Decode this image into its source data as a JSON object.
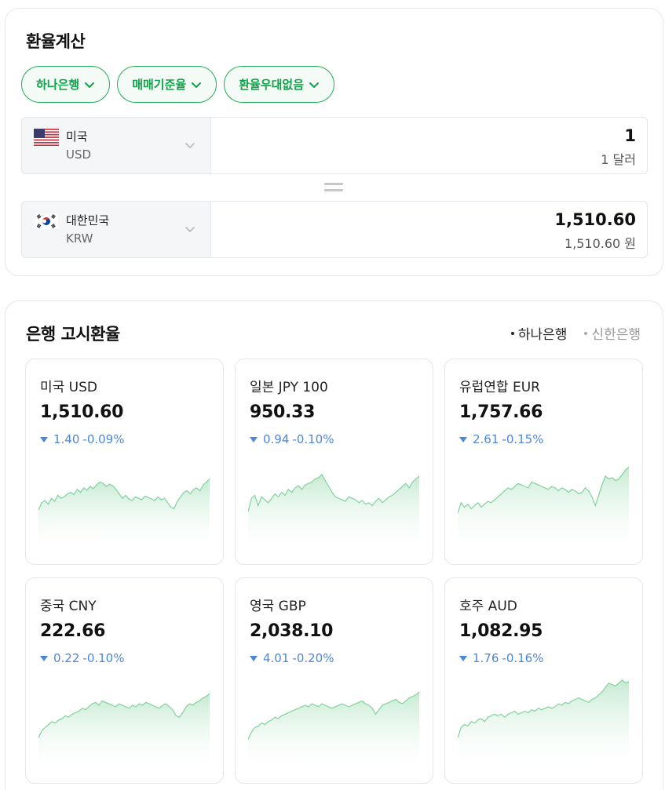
{
  "calculator": {
    "title": "환율계산",
    "chips": [
      {
        "label": "하나은행"
      },
      {
        "label": "매매기준율"
      },
      {
        "label": "환율우대없음"
      }
    ],
    "from": {
      "country": "미국",
      "code": "USD",
      "amount": "1",
      "amount_text": "1 달러"
    },
    "to": {
      "country": "대한민국",
      "code": "KRW",
      "amount": "1,510.60",
      "amount_text": "1,510.60 원"
    }
  },
  "rates": {
    "title": "은행 고시환율",
    "bank_tabs": [
      {
        "label": "하나은행",
        "active": true
      },
      {
        "label": "신한은행",
        "active": false
      }
    ],
    "cards": [
      {
        "name": "미국 USD",
        "value": "1,510.60",
        "change": "1.40",
        "change_pct": "-0.09%",
        "direction": "down",
        "trend": [
          42,
          52,
          55,
          50,
          58,
          54,
          62,
          58,
          60,
          64,
          66,
          63,
          70,
          66,
          72,
          69,
          74,
          71,
          76,
          80,
          78,
          74,
          77,
          75,
          70,
          64,
          58,
          62,
          57,
          55,
          60,
          58,
          56,
          61,
          59,
          57,
          55,
          60,
          56,
          58,
          52,
          46,
          44,
          54,
          60,
          66,
          68,
          64,
          70,
          72,
          68,
          76,
          80,
          84
        ]
      },
      {
        "name": "일본 JPY 100",
        "value": "950.33",
        "change": "0.94",
        "change_pct": "-0.10%",
        "direction": "down",
        "trend": [
          40,
          58,
          62,
          48,
          60,
          56,
          52,
          58,
          64,
          60,
          66,
          62,
          70,
          66,
          72,
          75,
          70,
          76,
          78,
          80,
          84,
          86,
          90,
          82,
          74,
          66,
          60,
          58,
          56,
          54,
          60,
          58,
          56,
          52,
          55,
          50,
          52,
          48,
          54,
          58,
          52,
          56,
          60,
          62,
          66,
          70,
          74,
          78,
          72,
          80,
          84,
          88
        ]
      },
      {
        "name": "유럽연합 EUR",
        "value": "1,757.66",
        "change": "2.61",
        "change_pct": "-0.15%",
        "direction": "down",
        "trend": [
          38,
          52,
          46,
          50,
          44,
          48,
          52,
          46,
          50,
          54,
          52,
          56,
          60,
          64,
          68,
          72,
          70,
          74,
          78,
          76,
          74,
          72,
          80,
          78,
          76,
          74,
          72,
          70,
          74,
          72,
          68,
          72,
          70,
          66,
          70,
          68,
          64,
          66,
          72,
          68,
          60,
          48,
          62,
          76,
          88,
          84,
          86,
          82,
          84,
          90,
          96,
          100
        ]
      },
      {
        "name": "중국 CNY",
        "value": "222.66",
        "change": "0.22",
        "change_pct": "-0.10%",
        "direction": "down",
        "trend": [
          30,
          40,
          44,
          48,
          52,
          50,
          54,
          56,
          60,
          58,
          62,
          64,
          66,
          70,
          68,
          72,
          76,
          78,
          74,
          80,
          78,
          76,
          74,
          72,
          76,
          74,
          72,
          70,
          74,
          72,
          76,
          74,
          78,
          76,
          74,
          72,
          70,
          74,
          76,
          72,
          68,
          60,
          58,
          64,
          72,
          76,
          74,
          78,
          80,
          84,
          86,
          90
        ]
      },
      {
        "name": "영국 GBP",
        "value": "2,038.10",
        "change": "4.01",
        "change_pct": "-0.20%",
        "direction": "down",
        "trend": [
          28,
          38,
          44,
          46,
          50,
          48,
          52,
          54,
          58,
          56,
          60,
          62,
          64,
          66,
          68,
          70,
          72,
          74,
          72,
          76,
          74,
          72,
          76,
          74,
          72,
          70,
          72,
          74,
          76,
          74,
          72,
          74,
          76,
          78,
          80,
          76,
          74,
          70,
          62,
          68,
          74,
          76,
          78,
          80,
          82,
          78,
          76,
          80,
          84,
          86,
          88,
          92
        ]
      },
      {
        "name": "호주 AUD",
        "value": "1,082.95",
        "change": "1.76",
        "change_pct": "-0.16%",
        "direction": "down",
        "trend": [
          30,
          44,
          48,
          46,
          52,
          50,
          54,
          56,
          52,
          58,
          60,
          62,
          60,
          62,
          58,
          62,
          64,
          66,
          62,
          64,
          66,
          64,
          68,
          66,
          70,
          68,
          70,
          72,
          70,
          72,
          76,
          74,
          78,
          76,
          80,
          82,
          84,
          82,
          80,
          78,
          82,
          84,
          88,
          92,
          98,
          104,
          102,
          100,
          104,
          108,
          104,
          106
        ]
      }
    ]
  },
  "colors": {
    "accent_green": "#11a24a",
    "chart_line": "#7fd39b",
    "change_blue": "#4d87d9"
  }
}
